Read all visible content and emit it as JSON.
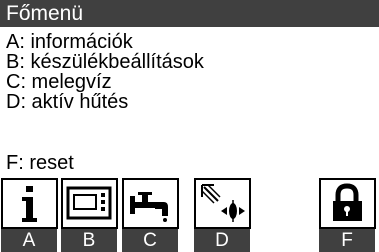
{
  "title": "Főmenü",
  "menu_items": [
    "A: információk",
    "B: készülékbeállítások",
    "C: melegvíz",
    "D: aktív hűtés"
  ],
  "reset_item": "F: reset",
  "softkeys": [
    "A",
    "B",
    "C",
    "D",
    "F"
  ],
  "icons": [
    "info-icon",
    "device-settings-icon",
    "tap-water-icon",
    "active-cooling-icon",
    "lock-icon"
  ],
  "colors": {
    "bar": "#404040",
    "text_on_bar": "#ffffff",
    "text": "#000000"
  }
}
